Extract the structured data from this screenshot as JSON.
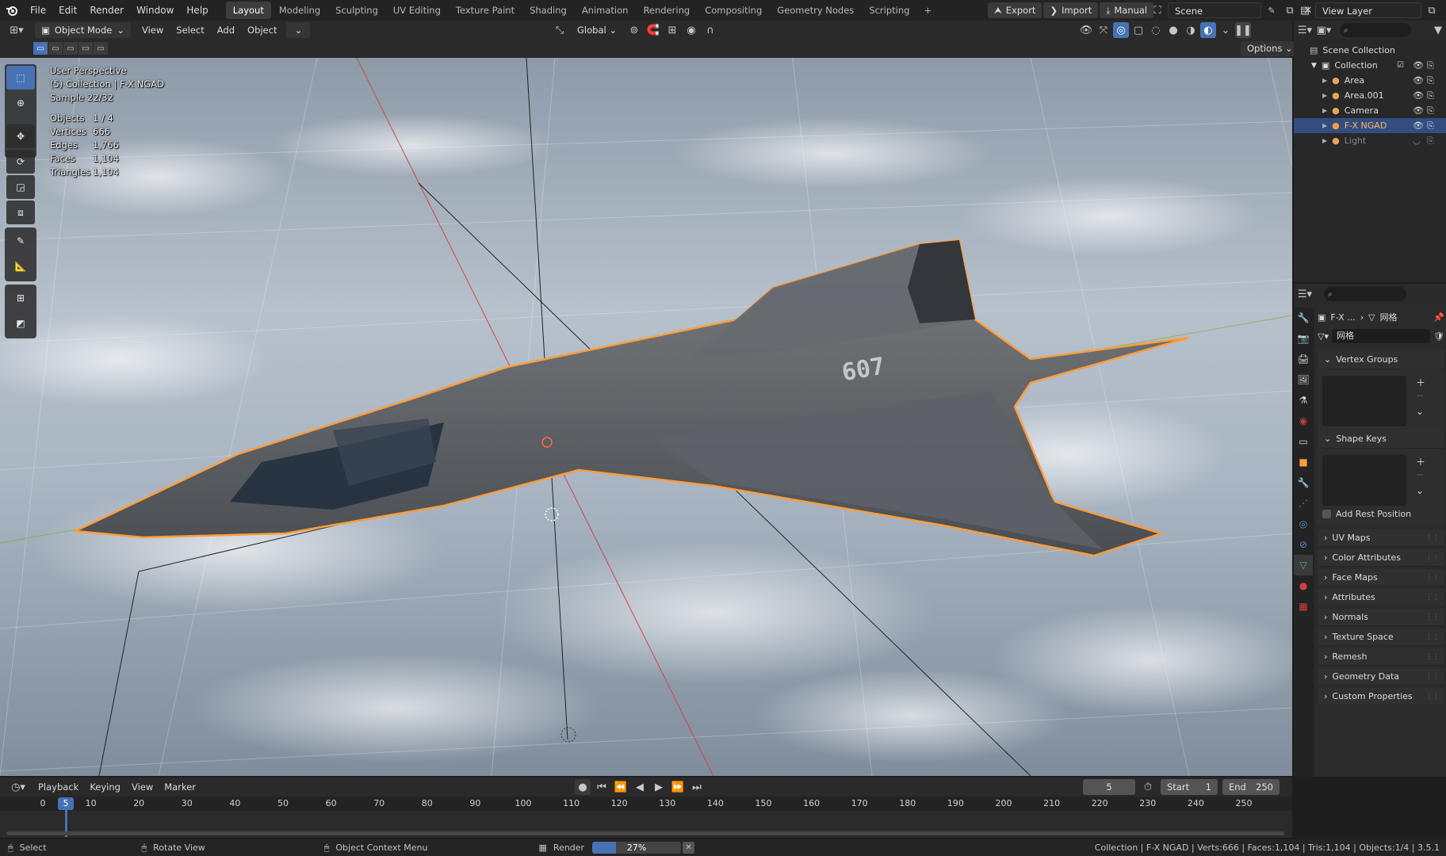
{
  "topbar": {
    "menus": [
      "File",
      "Edit",
      "Render",
      "Window",
      "Help"
    ],
    "workspaces": [
      "Layout",
      "Modeling",
      "Sculpting",
      "UV Editing",
      "Texture Paint",
      "Shading",
      "Animation",
      "Rendering",
      "Compositing",
      "Geometry Nodes",
      "Scripting"
    ],
    "active_workspace": "Layout",
    "add_tab": "+",
    "export_label": "Export",
    "import_label": "Import",
    "manual_label": "Manual",
    "scene_label": "Scene",
    "view_layer_label": "View Layer"
  },
  "viewport_header": {
    "mode": "Object Mode",
    "menus": [
      "View",
      "Select",
      "Add",
      "Object"
    ],
    "transform_orientation": "Global",
    "options_label": "Options"
  },
  "overlay": {
    "view_name": "User Perspective",
    "collection": "(5) Collection | F-X NGAD",
    "sample": "Sample 22/32",
    "stats": [
      {
        "label": "Objects",
        "value": "1 / 4"
      },
      {
        "label": "Vertices",
        "value": "666"
      },
      {
        "label": "Edges",
        "value": "1,766"
      },
      {
        "label": "Faces",
        "value": "1,104"
      },
      {
        "label": "Triangles",
        "value": "1,104"
      }
    ],
    "tail_number": "607"
  },
  "outliner": {
    "root": "Scene Collection",
    "collection": "Collection",
    "items": [
      {
        "name": "Area",
        "color": "#e8a35a",
        "selected": false,
        "hidden": false
      },
      {
        "name": "Area.001",
        "color": "#e8a35a",
        "selected": false,
        "hidden": false
      },
      {
        "name": "Camera",
        "color": "#e8a35a",
        "selected": false,
        "hidden": false
      },
      {
        "name": "F-X NGAD",
        "color": "#ff9d3b",
        "selected": true,
        "hidden": false
      },
      {
        "name": "Light",
        "color": "#e8a35a",
        "selected": false,
        "hidden": true
      }
    ]
  },
  "properties": {
    "breadcrumb_object": "F-X ...",
    "breadcrumb_data": "网格",
    "mesh_name": "网格",
    "vertex_groups_label": "Vertex Groups",
    "shape_keys_label": "Shape Keys",
    "add_rest_position_label": "Add Rest Position",
    "collapsed_panels": [
      "UV Maps",
      "Color Attributes",
      "Face Maps",
      "Attributes",
      "Normals",
      "Texture Space",
      "Remesh",
      "Geometry Data",
      "Custom Properties"
    ]
  },
  "timeline": {
    "menus": [
      "Playback",
      "Keying",
      "View",
      "Marker"
    ],
    "current_frame": "5",
    "start_label": "Start",
    "start_value": "1",
    "end_label": "End",
    "end_value": "250",
    "ticks": [
      "0",
      "10",
      "20",
      "30",
      "40",
      "50",
      "60",
      "70",
      "80",
      "90",
      "100",
      "110",
      "120",
      "130",
      "140",
      "150",
      "160",
      "170",
      "180",
      "190",
      "200",
      "210",
      "220",
      "230",
      "240",
      "250"
    ]
  },
  "statusbar": {
    "select_label": "Select",
    "rotate_label": "Rotate View",
    "context_label": "Object Context Menu",
    "render_label": "Render",
    "render_progress": 27,
    "render_progress_text": "27%",
    "info": "Collection | F-X NGAD | Verts:666 | Faces:1,104 | Tris:1,104 | Objects:1/4 | 3.5.1"
  },
  "colors": {
    "accent": "#4772b3",
    "selection_outline": "#ff9d3b",
    "x_axis": "#d04040",
    "y_axis": "#7ab040"
  }
}
